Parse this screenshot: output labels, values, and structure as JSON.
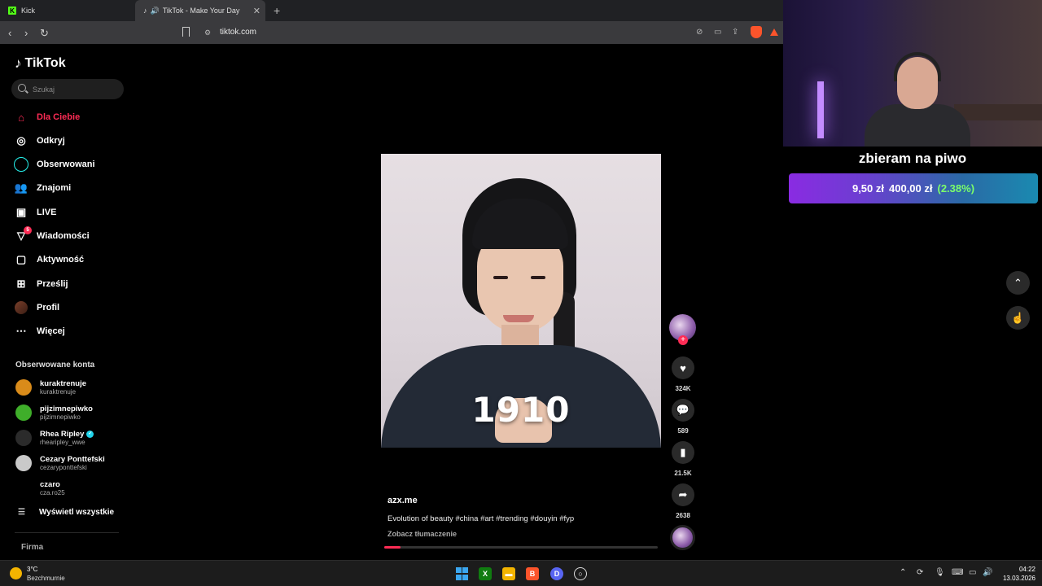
{
  "browser": {
    "tabs": [
      {
        "label": "Kick",
        "icon": "kick-icon"
      },
      {
        "label": "TikTok - Make Your Day",
        "icon": "tiktok-icon",
        "active": true
      }
    ],
    "url": "tiktok.com"
  },
  "tiktok": {
    "logo_text": "TikTok",
    "search": {
      "placeholder": "Szukaj"
    },
    "menu": [
      {
        "label": "Dla Ciebie",
        "icon": "home-icon",
        "active": true
      },
      {
        "label": "Odkryj",
        "icon": "compass-icon"
      },
      {
        "label": "Obserwowani",
        "icon": "following-icon"
      },
      {
        "label": "Znajomi",
        "icon": "friends-icon"
      },
      {
        "label": "LIVE",
        "icon": "live-icon"
      },
      {
        "label": "Wiadomości",
        "icon": "messages-icon",
        "badge": "5"
      },
      {
        "label": "Aktywność",
        "icon": "activity-icon"
      },
      {
        "label": "Prześlij",
        "icon": "upload-icon"
      },
      {
        "label": "Profil",
        "icon": "profile-avatar"
      },
      {
        "label": "Więcej",
        "icon": "more-icon"
      }
    ],
    "followed_title": "Obserwowane konta",
    "followed": [
      {
        "name": "kuraktrenuje",
        "handle": "kuraktrenuje",
        "color": "#d98b1a"
      },
      {
        "name": "pijzimnepiwko",
        "handle": "pijzimnepiwko",
        "color": "#3fae2a"
      },
      {
        "name": "Rhea Ripley",
        "handle": "rhearipley_wwe",
        "color": "#2b2b2b",
        "verified": true
      },
      {
        "name": "Cezary Ponttefski",
        "handle": "cezaryponttefski",
        "color": "#c9c9c9"
      },
      {
        "name": "czaro",
        "handle": "cza.ro25",
        "color": "#000000"
      }
    ],
    "show_all": "Wyświetl wszystkie",
    "footer": "Firma",
    "video": {
      "overlay_text": "1910",
      "author": "azx.me",
      "description": "Evolution of beauty #china #art #trending #douyin #fyp",
      "translate": "Zobacz tłumaczenie",
      "progress": 0.06,
      "likes": "324K",
      "comments": "589",
      "saves": "21.5K",
      "shares": "2638"
    }
  },
  "stream_overlay": {
    "goal_title": "zbieram na piwo",
    "goal_current": "9,50 zł",
    "goal_target": "400,00 zł",
    "goal_percent": "(2.38%)"
  },
  "taskbar": {
    "temperature": "3°C",
    "weather": "Bezchmurnie",
    "time": "04:22",
    "date": "13.03.2026"
  }
}
